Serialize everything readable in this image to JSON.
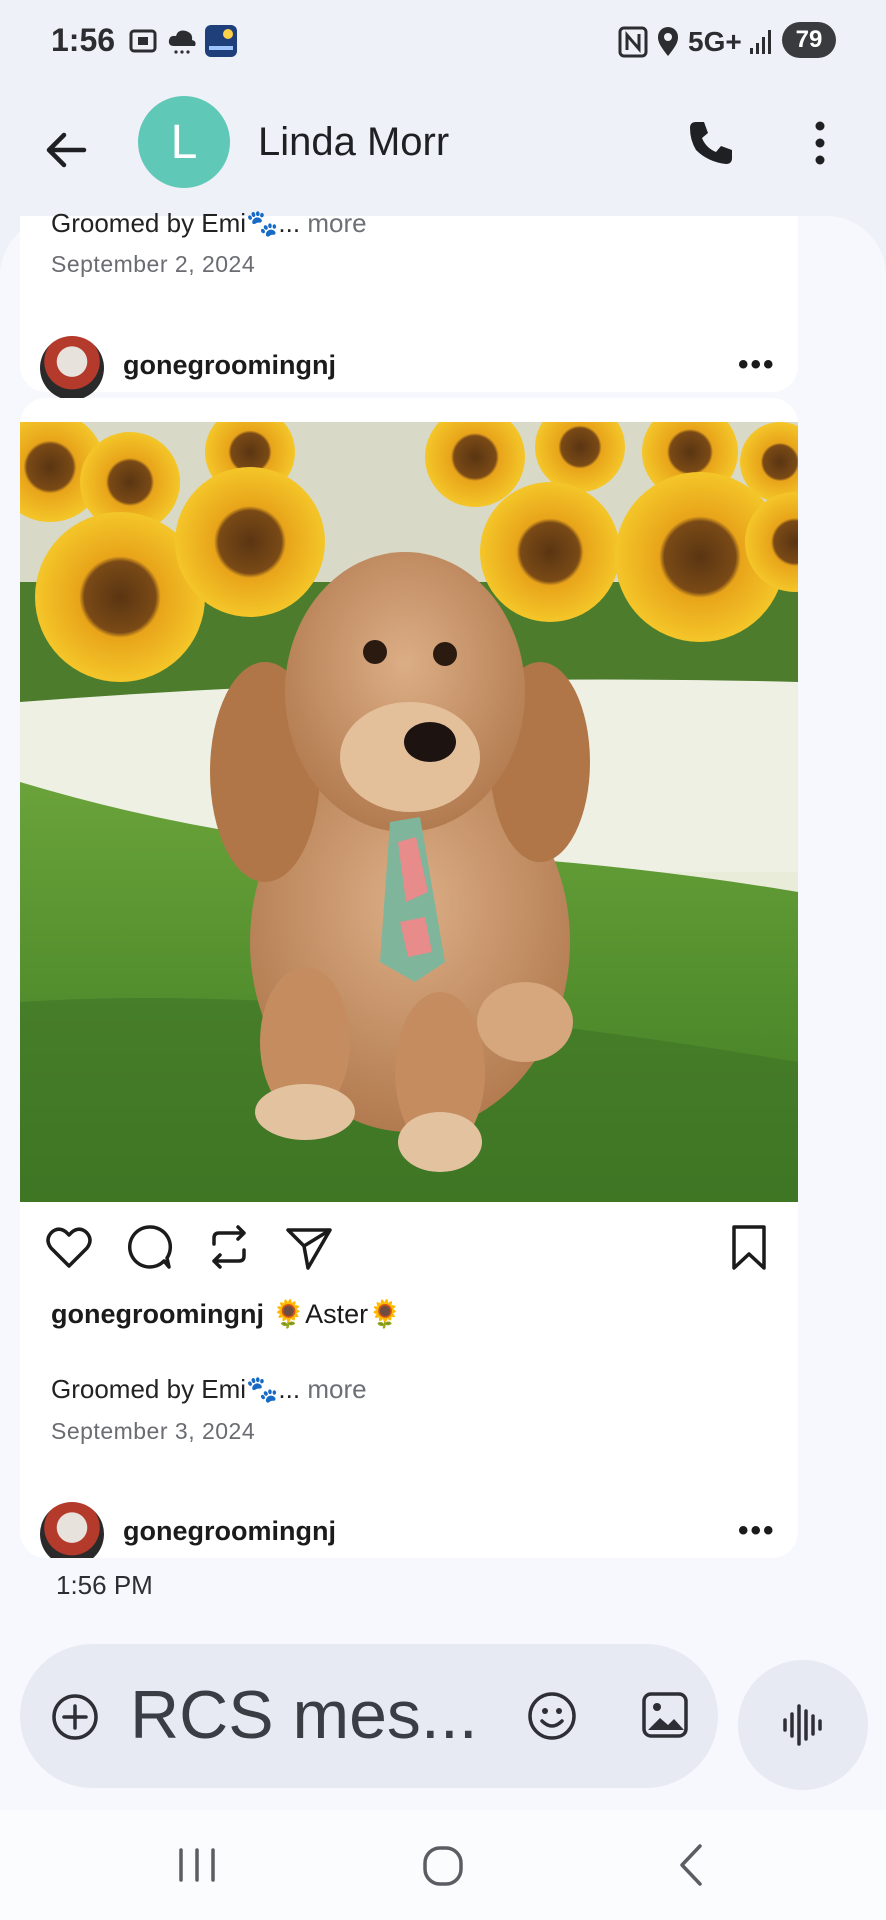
{
  "status_bar": {
    "time": "1:56",
    "network": "5G+",
    "battery": "79",
    "icons": [
      "screenshot-icon",
      "weather-cloud-icon",
      "weather-app-icon",
      "nfc-icon",
      "location-icon",
      "signal-icon"
    ]
  },
  "app_bar": {
    "avatar_letter": "L",
    "contact_name": "Linda Morr",
    "icons": [
      "back-arrow-icon",
      "phone-icon",
      "more-vert-icon"
    ]
  },
  "posts": [
    {
      "caption": "Groomed by Emi🐾...",
      "more_label": "more",
      "date": "September 2, 2024",
      "next_handle": "gonegroomingnj",
      "dots": "•••"
    },
    {
      "handle": "gonegroomingnj",
      "title_text": "🌻Aster🌻",
      "caption": "Groomed by Emi🐾...",
      "more_label": "more",
      "date": "September 3, 2024",
      "next_handle": "gonegroomingnj",
      "dots": "•••"
    }
  ],
  "message": {
    "time": "1:56 PM"
  },
  "composer": {
    "placeholder": "RCS mes..."
  },
  "colors": {
    "avatar": "#5fc8b6",
    "background": "#eef1f8",
    "chat_background": "#f7f8fd",
    "composer": "#e7eaf3"
  }
}
